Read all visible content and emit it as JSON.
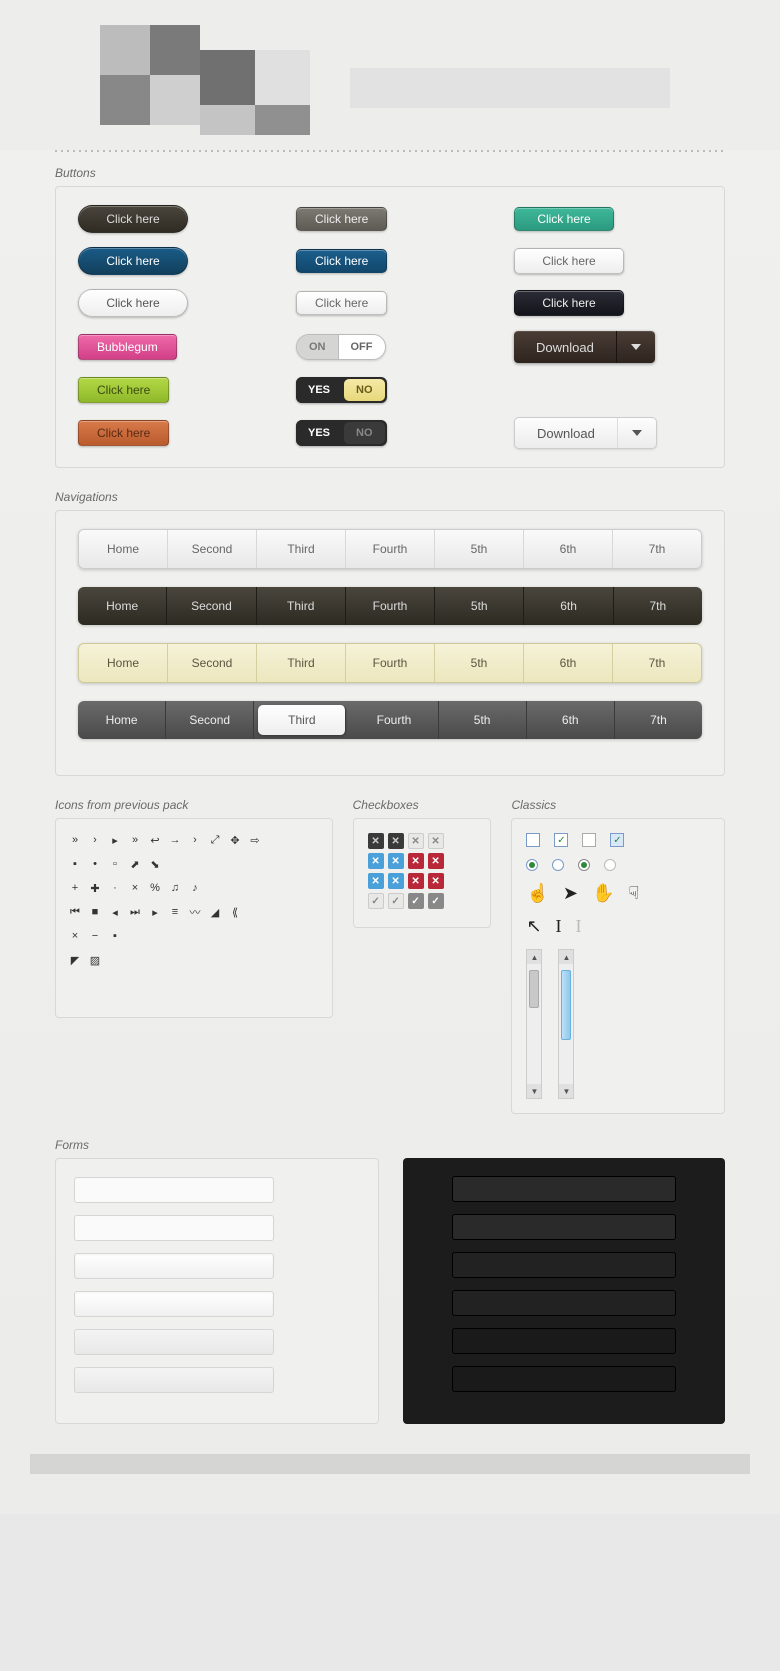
{
  "sections": {
    "buttons": "Buttons",
    "navigations": "Navigations",
    "icons": "Icons from previous pack",
    "checkboxes": "Checkboxes",
    "classics": "Classics",
    "forms": "Forms"
  },
  "buttons": {
    "click_here": "Click here",
    "bubblegum": "Bubblegum",
    "download": "Download",
    "on": "ON",
    "off": "OFF",
    "yes": "YES",
    "no": "NO"
  },
  "nav_items": [
    "Home",
    "Second",
    "Third",
    "Fourth",
    "5th",
    "6th",
    "7th"
  ],
  "nav_active_index": 2,
  "checkbox_glyph_x": "✕",
  "checkbox_glyph_v": "✓",
  "classic_check_v": "✓"
}
